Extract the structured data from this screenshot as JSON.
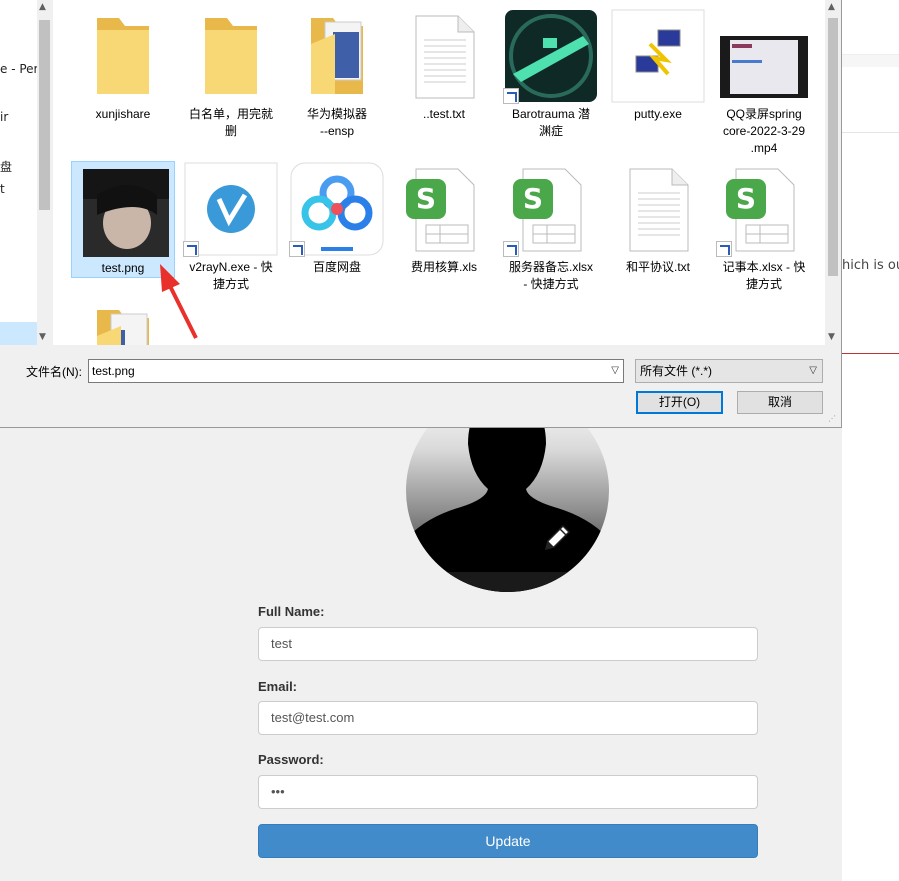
{
  "background_page": {
    "right_text": "hich is out",
    "form": {
      "full_name_label": "Full Name:",
      "full_name_value": "test",
      "email_label": "Email:",
      "email_value": "test@test.com",
      "password_label": "Password:",
      "password_value": "•••",
      "update_button": "Update"
    }
  },
  "dialog": {
    "nav_pane": [
      "e - Per",
      "ir",
      "盘",
      "t"
    ],
    "files": [
      {
        "name_lines": [
          "xunjishare"
        ],
        "type": "folder"
      },
      {
        "name_lines": [
          "白名单，用完就",
          "删"
        ],
        "type": "folder"
      },
      {
        "name_lines": [
          "华为模拟器",
          "--ensp"
        ],
        "type": "folder-doc"
      },
      {
        "name_lines": [
          "..test.txt"
        ],
        "type": "txt"
      },
      {
        "name_lines": [
          "Barotrauma 潜",
          "渊症"
        ],
        "type": "game",
        "shortcut": true
      },
      {
        "name_lines": [
          "putty.exe"
        ],
        "type": "putty"
      },
      {
        "name_lines": [
          "QQ录屏spring",
          "core-2022-3-29",
          ".mp4"
        ],
        "type": "video"
      },
      {
        "name_lines": [
          "test.png"
        ],
        "type": "photo",
        "selected": true
      },
      {
        "name_lines": [
          "v2rayN.exe - 快",
          "捷方式"
        ],
        "type": "v2ray",
        "shortcut": true
      },
      {
        "name_lines": [
          "百度网盘"
        ],
        "type": "baidu",
        "shortcut": true
      },
      {
        "name_lines": [
          "费用核算.xls"
        ],
        "type": "xls"
      },
      {
        "name_lines": [
          "服务器备忘.xlsx",
          "- 快捷方式"
        ],
        "type": "xls",
        "shortcut": true
      },
      {
        "name_lines": [
          "和平协议.txt"
        ],
        "type": "txt"
      },
      {
        "name_lines": [
          "记事本.xlsx - 快",
          "捷方式"
        ],
        "type": "xls",
        "shortcut": true
      },
      {
        "name_lines": [
          ""
        ],
        "type": "folder-doc"
      }
    ],
    "filename_label": "文件名(N):",
    "filename_value": "test.png",
    "filter_value": "所有文件 (*.*)",
    "open_button": "打开(O)",
    "cancel_button": "取消"
  },
  "colors": {
    "selection": "#cce8ff",
    "update_button": "#428bca",
    "annotation_arrow": "#e8312a"
  }
}
